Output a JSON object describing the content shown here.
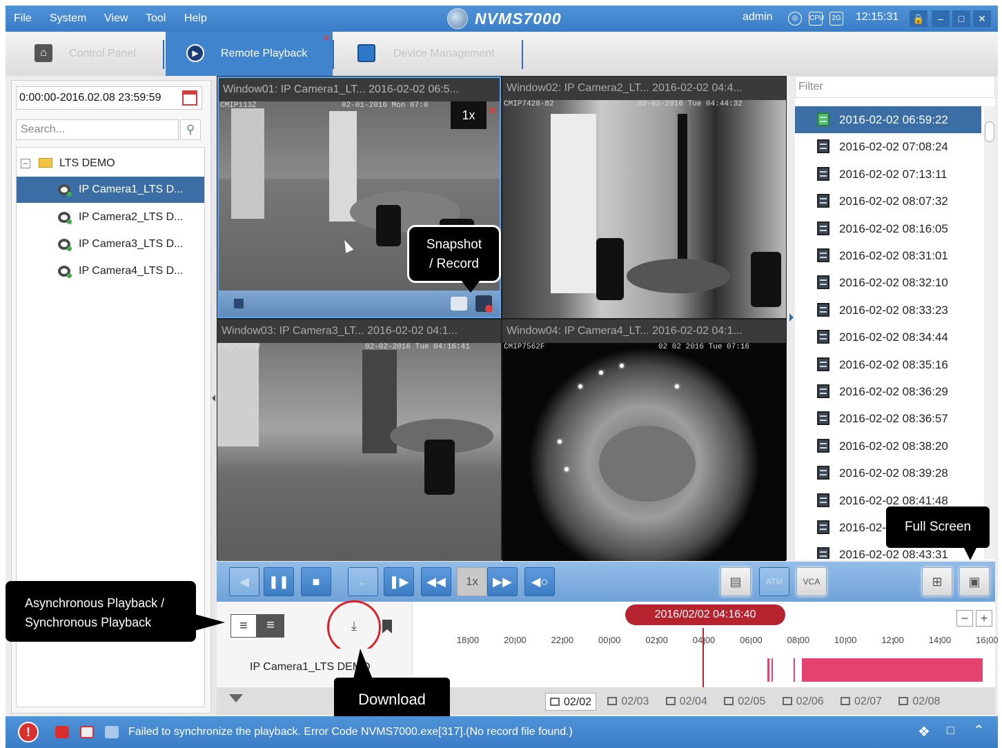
{
  "menubar": {
    "items": [
      "File",
      "System",
      "View",
      "Tool",
      "Help"
    ],
    "app_title": "NVMS7000",
    "user": "admin",
    "cpu_icon_label": "CPU",
    "net_icon_label": "2G",
    "clock": "12:15:31",
    "icons": [
      "globe-icon",
      "cpu-icon",
      "network-icon",
      "lock-icon",
      "minimize-icon",
      "maximize-icon",
      "close-icon"
    ]
  },
  "tabs": [
    {
      "label": "Control Panel",
      "icon": "home-icon",
      "active": false
    },
    {
      "label": "Remote Playback",
      "icon": "play-icon",
      "active": true
    },
    {
      "label": "Device Management",
      "icon": "devices-icon",
      "active": false
    }
  ],
  "left_panel": {
    "date_range": "0:00:00-2016.02.08 23:59:59",
    "search_placeholder": "Search...",
    "group_name": "LTS DEMO",
    "cameras": [
      "IP Camera1_LTS D...",
      "IP Camera2_LTS D...",
      "IP Camera3_LTS D...",
      "IP Camera4_LTS D..."
    ],
    "selected_camera_index": 0
  },
  "windows": [
    {
      "title": "Window01: IP Camera1_LT...   2016-02-02 06:5...",
      "osd_left": "CMIP113Z",
      "osd_right": "02-01-2016 Mon 07:0"
    },
    {
      "title": "Window02: IP Camera2_LT...   2016-02-02 04:4...",
      "osd_left": "CMIP7428-82",
      "osd_right": "02-02-2016 Tue 04:44:32"
    },
    {
      "title": "Window03: IP Camera3_LT...   2016-02-02 04:1...",
      "osd_left": "CMIP2424W",
      "osd_right": "02-02-2016 Tue 04:16:41"
    },
    {
      "title": "Window04: IP Camera4_LT...   2016-02-02 04:1...",
      "osd_left": "CMIP7562F",
      "osd_right": "02 02 2016 Tue 07:16"
    }
  ],
  "window1_overlay": {
    "speed": "1x"
  },
  "callouts": {
    "snapshot_line1": "Snapshot",
    "snapshot_line2": "/ Record",
    "full_screen": "Full Screen",
    "async_line1": "Asynchronous Playback /",
    "async_line2": "Synchronous Playback",
    "download": "Download"
  },
  "file_list": {
    "filter_placeholder": "Filter",
    "files": [
      "2016-02-02 06:59:22",
      "2016-02-02 07:08:24",
      "2016-02-02 07:13:11",
      "2016-02-02 08:07:32",
      "2016-02-02 08:16:05",
      "2016-02-02 08:31:01",
      "2016-02-02 08:32:10",
      "2016-02-02 08:33:23",
      "2016-02-02 08:34:44",
      "2016-02-02 08:35:16",
      "2016-02-02 08:36:29",
      "2016-02-02 08:36:57",
      "2016-02-02 08:38:20",
      "2016-02-02 08:39:28",
      "2016-02-02 08:41:48",
      "2016-02-",
      "2016-02-02 08:43:31"
    ],
    "selected_index": 0
  },
  "controls": {
    "speed": "1x",
    "buttons": [
      "reverse-play-icon",
      "pause-icon",
      "stop-icon",
      "step-back-icon",
      "step-forward-icon",
      "slow-icon",
      "fast-icon",
      "volume-icon",
      "file-list-icon",
      "atm-icon",
      "vca-icon",
      "layout-icon",
      "fullscreen-icon"
    ],
    "atm_label": "ATM",
    "vca_label": "VCA"
  },
  "timeline": {
    "current_time": "2016/02/02 04:16:40",
    "ticks": [
      "18:00",
      "20:00",
      "22:00",
      "00:00",
      "02:00",
      "04:00",
      "06:00",
      "08:00",
      "10:00",
      "12:00",
      "14:00",
      "16:00"
    ],
    "row_label": "IP Camera1_LTS DEMO",
    "zoom_out": "−",
    "zoom_in": "+"
  },
  "date_strip": {
    "days": [
      "02/02",
      "02/03",
      "02/04",
      "02/05",
      "02/06",
      "02/07",
      "02/08"
    ],
    "active_index": 0
  },
  "status": {
    "alarm_glyph": "!",
    "message": "Failed to synchronize the playback. Error Code NVMS7000.exe[317].(No record file found.)"
  },
  "colors": {
    "accent": "#3a7dc7",
    "selection": "#3a6ea5",
    "record_bar": "#e5436f",
    "timeline_marker": "#b6232f"
  }
}
